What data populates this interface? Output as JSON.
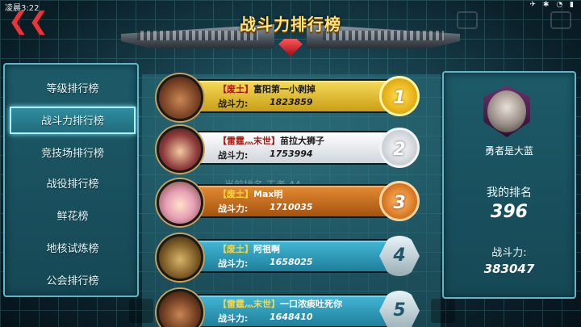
{
  "status_bar": {
    "time": "凌晨3:22",
    "icons": "✈ ✱ ◔ ▮"
  },
  "header": {
    "title": "战斗力排行榜",
    "back_glyph": "❮❮"
  },
  "sidebar": {
    "items": [
      {
        "label": "等级排行榜",
        "active": false
      },
      {
        "label": "战斗力排行榜",
        "active": true
      },
      {
        "label": "竞技场排行榜",
        "active": false
      },
      {
        "label": "战役排行榜",
        "active": false
      },
      {
        "label": "鲜花榜",
        "active": false
      },
      {
        "label": "地核试炼榜",
        "active": false
      },
      {
        "label": "公会排行榜",
        "active": false
      }
    ]
  },
  "rankings": {
    "power_label": "战斗力:",
    "rows": [
      {
        "rank": "1",
        "tag": "【废土】",
        "name": "富阳第一小剥掉",
        "power": "1823859",
        "style": "gold"
      },
      {
        "rank": "2",
        "tag": "【雷霆灬末世】",
        "name": "苗拉大狮子",
        "power": "1753994",
        "style": "silver"
      },
      {
        "rank": "3",
        "tag": "【废土】",
        "name": "Max明",
        "power": "1710035",
        "style": "bronze"
      },
      {
        "rank": "4",
        "tag": "【废土】",
        "name": "阿祖啊",
        "power": "1658025",
        "style": "blue"
      },
      {
        "rank": "5",
        "tag": "【雷霆灬末世】",
        "name": "一口浓痰吐死你",
        "power": "1648410",
        "style": "blue"
      }
    ],
    "watermark": "当前排名    王者 44"
  },
  "me": {
    "name": "勇者是大蓝",
    "rank_label": "我的排名",
    "rank_value": "396",
    "power_label": "战斗力:",
    "power_value": "383047"
  },
  "colors": {
    "gold": "#d8b324",
    "silver": "#e9edf0",
    "bronze": "#c8741f",
    "blue": "#2fa2c3"
  }
}
